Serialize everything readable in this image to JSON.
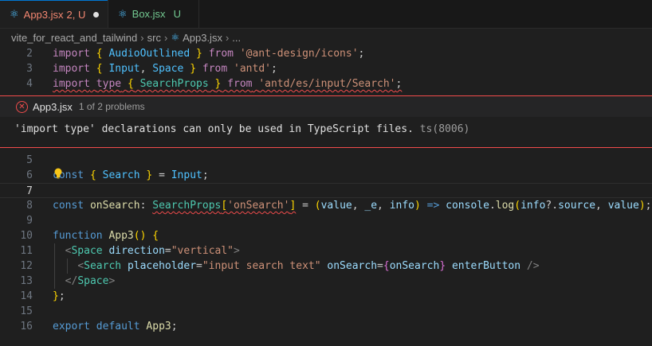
{
  "tabs": [
    {
      "label": "App3.jsx",
      "badge": "2, U",
      "active": true,
      "dirty": true
    },
    {
      "label": "Box.jsx",
      "badge": "U",
      "active": false
    }
  ],
  "breadcrumb": [
    "vite_for_react_and_tailwind",
    "src",
    "App3.jsx",
    "..."
  ],
  "peek": {
    "file": "App3.jsx",
    "count": "1 of 2 problems",
    "message": "'import type' declarations can only be used in TypeScript files.",
    "code": "ts(8006)"
  },
  "lines": [
    {
      "num": "2",
      "text": "import { AudioOutlined } from '@ant-design/icons';"
    },
    {
      "num": "3",
      "text": "import { Input, Space } from 'antd';"
    },
    {
      "num": "4",
      "text": "import type { SearchProps } from 'antd/es/input/Search';"
    },
    {
      "num": "5",
      "text": ""
    },
    {
      "num": "6",
      "text": "const { Search } = Input;"
    },
    {
      "num": "7",
      "text": ""
    },
    {
      "num": "8",
      "text": "const onSearch: SearchProps['onSearch'] = (value, _e, info) => console.log(info?.source, value);"
    },
    {
      "num": "9",
      "text": ""
    },
    {
      "num": "10",
      "text": "function App3() {"
    },
    {
      "num": "11",
      "text": "  <Space direction=\"vertical\">"
    },
    {
      "num": "12",
      "text": "    <Search placeholder=\"input search text\" onSearch={onSearch} enterButton />"
    },
    {
      "num": "13",
      "text": "  </Space>"
    },
    {
      "num": "14",
      "text": "};"
    },
    {
      "num": "15",
      "text": ""
    },
    {
      "num": "16",
      "text": "export default App3;"
    }
  ],
  "current_line": "7",
  "colors": {
    "error": "#f14c4c",
    "tab_accent": "#0078d4",
    "background": "#1f1f1f"
  }
}
